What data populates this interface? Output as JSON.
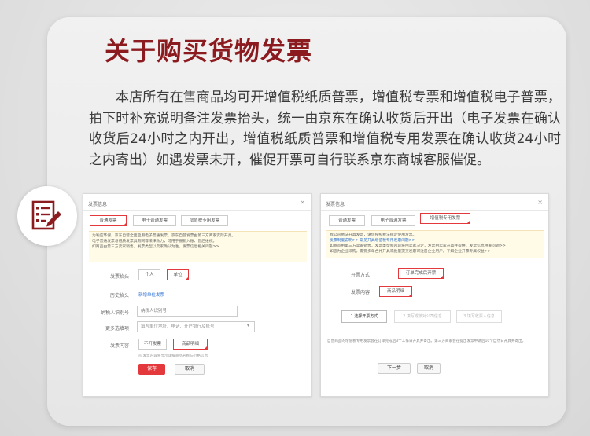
{
  "title": "关于购买货物发票",
  "paragraph": "本店所有在售商品均可开增值税纸质普票，增值税专票和增值税电子普票，拍下时补充说明备注发票抬头，统一由京东在确认收货后开出（电子发票在确认收货后24小时之内开出，增值税纸质普票和增值税专用发票在确认收货24小时之内寄出）如遇发票未开，催促开票可自行联系京东商城客服催促。",
  "icon": "invoice-checklist-pen-icon",
  "colors": {
    "accent": "#8c1b1f",
    "jd_red": "#e4393c",
    "link_blue": "#2a6fd4"
  },
  "dialog_left": {
    "header": "发票信息",
    "close": "×",
    "tabs": [
      "普通发票",
      "电子普通发票",
      "增值税专用发票"
    ],
    "notice_lines": [
      "为响应环保，京东自营全面启用电子普通发票，京东自营发票由第三方商家实际开具。",
      "电子普通发票与纸质发票具有同等法律效力，可用于报销入账、售后维权。",
      "如商品由第三方卖家销售，发票类型以卖家确认为准。发票信息相关问题>>"
    ],
    "notice_link": "发票信息相关问题>>",
    "title_label": "发票抬头",
    "title_options": [
      "个人",
      "单位"
    ],
    "history_label": "历史抬头",
    "history_link": "新增单位发票",
    "taxid_label": "纳税人识别号",
    "taxid_placeholder": "纳税人识别号",
    "more_label": "更多选填项",
    "more_placeholder": "填写单位地址、电话、开户银行及账号",
    "content_label": "发票内容",
    "content_options": [
      "不开发票",
      "商品明细"
    ],
    "content_hint": "◎ 发票内容将显示详细商品名称与价格信息",
    "save": "保存",
    "cancel": "取消"
  },
  "dialog_right": {
    "header": "发票信息",
    "close": "×",
    "tabs": [
      "普通发票",
      "电子普通发票",
      "增值税专用发票"
    ],
    "notice_lines": [
      "我公司依法开具发票，请您按照税法规定使用发票。",
      "发票制度说明>>  常见开具增值税专用发票问题>>",
      "如商品由第三方卖家销售，发票类型和内容将由卖家决定，发票由卖家开具并提供。发票信息相关问题>>",
      "如您为企业采购，需要多单合并开具或批量提交发票可注册企业用户。了解企业开票专属权益>>"
    ],
    "notice_link": "发票信息相关问题>>",
    "method_label": "开票方式",
    "method_option": "订单完成后开票",
    "content_label": "发票内容",
    "content_option": "商品明细",
    "steps": [
      "1.选择开票方式",
      "2.填写或核对公司信息",
      "3.填写收票人信息"
    ],
    "footnote": "自营商品的增值税专用发票会在订单完成后3个工作日开具并寄出。第三方商家会在提出发票申请后10个自然日开具并寄出。",
    "next": "下一步",
    "cancel": "取消"
  }
}
